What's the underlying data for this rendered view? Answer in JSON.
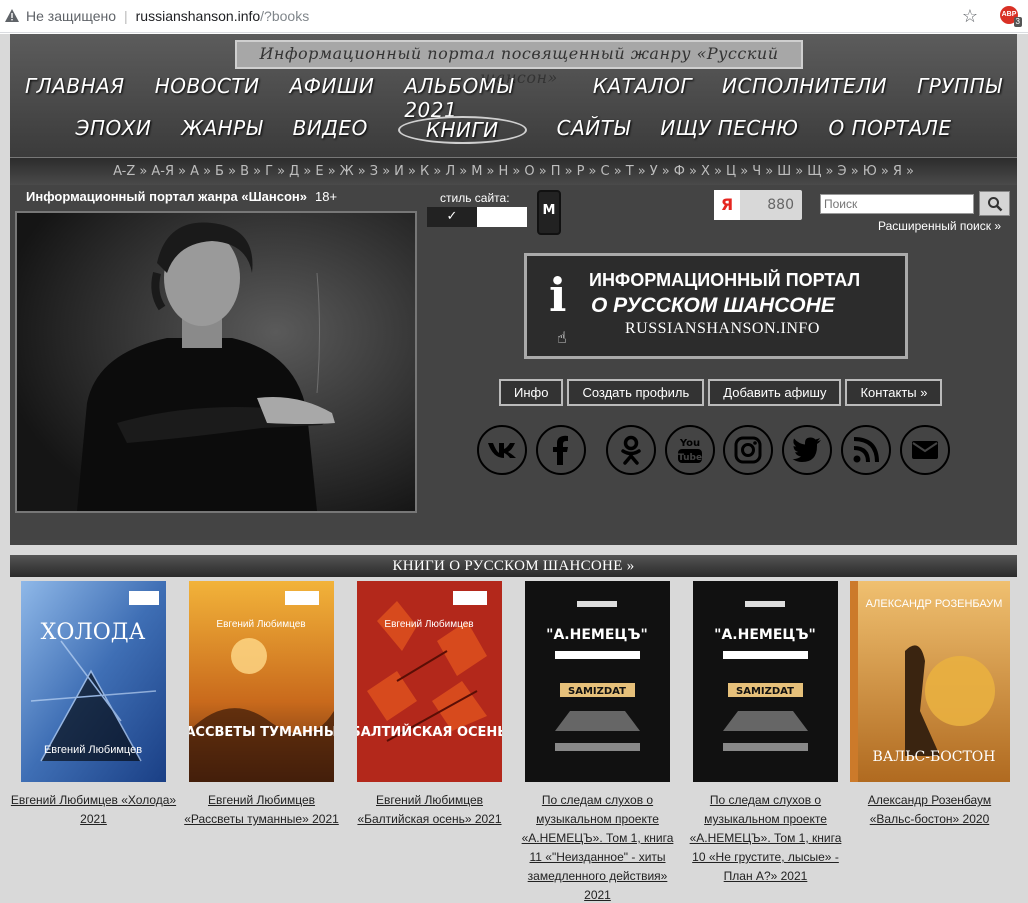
{
  "browser": {
    "not_secure": "Не защищено",
    "url_host": "russianshanson.info",
    "url_path": "/?books",
    "ext_label": "ABP",
    "ext_badge": "3"
  },
  "header": {
    "slogan": "Информационный портал посвященный жанру «Русский шансон»",
    "nav_row1": [
      "ГЛАВНАЯ",
      "НОВОСТИ",
      "АФИШИ",
      "АЛЬБОМЫ 2021",
      "КАТАЛОГ",
      "ИСПОЛНИТЕЛИ",
      "ГРУППЫ"
    ],
    "nav_row2": [
      "ЭПОХИ",
      "ЖАНРЫ",
      "ВИДЕО",
      "КНИГИ",
      "САЙТЫ",
      "ИЩУ ПЕСНЮ",
      "О ПОРТАЛЕ"
    ],
    "active_nav": "КНИГИ"
  },
  "alphabet": [
    "A-Z »",
    "А-Я »",
    "А »",
    "Б »",
    "В »",
    "Г »",
    "Д »",
    "Е »",
    "Ж »",
    "З »",
    "И »",
    "К »",
    "Л »",
    "М »",
    "Н »",
    "О »",
    "П »",
    "Р »",
    "С »",
    "Т »",
    "У »",
    "Ф »",
    "Х »",
    "Ц »",
    "Ч »",
    "Ш »",
    "Щ »",
    "Э »",
    "Ю »",
    "Я »"
  ],
  "main": {
    "title": "Информационный портал жанра «Шансон»",
    "age": "18+",
    "style_label": "стиль сайта:",
    "style_check": "✓",
    "mobile_label": "M",
    "yandex_logo": "Я",
    "yandex_count": "880",
    "search_placeholder": "Поиск",
    "adv_search": "Расширенный поиск »",
    "banner_i": "i",
    "banner_line1": "ИНФОРМАЦИОННЫЙ ПОРТАЛ",
    "banner_line2": "О РУССКОМ ШАНСОНЕ",
    "banner_line3": "RUSSIANSHANSON.INFO",
    "buttons": [
      "Инфо",
      "Создать профиль",
      "Добавить афишу",
      "Контакты »"
    ],
    "social": [
      "vk-icon",
      "facebook-icon",
      "odnoklassniki-icon",
      "youtube-icon",
      "instagram-icon",
      "twitter-icon",
      "rss-icon",
      "mail-icon"
    ]
  },
  "books": {
    "header": "КНИГИ О РУССКОМ ШАНСОНЕ »",
    "items": [
      {
        "caption": "Евгений Любимцев «Холода» 2021",
        "cover_title": "ХОЛОДА",
        "cover_author": "Евгений Любимцев",
        "cover_color": "#3f6fb5"
      },
      {
        "caption": "Евгений Любимцев «Рассветы туманные» 2021",
        "cover_title": "РАССВЕТЫ ТУМАННЫЕ",
        "cover_author": "Евгений Любимцев",
        "cover_color": "#c96a1c"
      },
      {
        "caption": "Евгений Любимцев «Балтийская осень» 2021",
        "cover_title": "БАЛТИЙСКАЯ ОСЕНЬ",
        "cover_author": "Евгений Любимцев",
        "cover_color": "#b3281b"
      },
      {
        "caption": "По следам слухов о музыкальном проекте «А.НЕМЕЦЪ». Том 1, книга 11 «\"Неизданное\" - хиты замедленного действия» 2021",
        "cover_title": "\"А.НЕМЕЦЪ\"",
        "cover_author": "SAMIZDAT",
        "cover_color": "#111111"
      },
      {
        "caption": "По следам слухов о музыкальном проекте «А.НЕМЕЦЪ». Том 1, книга 10 «Не грустите, лысые» - План А?» 2021",
        "cover_title": "\"А.НЕМЕЦЪ\"",
        "cover_author": "SAMIZDAT",
        "cover_color": "#111111"
      },
      {
        "caption": "Александр Розенбаум «Вальс-бостон» 2020",
        "cover_title": "ВАЛЬС-БОСТОН",
        "cover_author": "АЛЕКСАНДР РОЗЕНБАУМ",
        "cover_color": "#d98a2a"
      }
    ]
  }
}
